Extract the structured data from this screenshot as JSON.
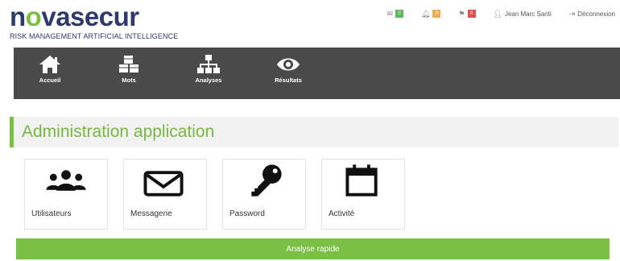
{
  "brand": {
    "name_part1": "n",
    "name_o": "o",
    "name_part2": "vasecur",
    "tagline": "RISK MANAGEMENT ARTIFICIAL INTELLIGENCE",
    "colors": {
      "navy": "#2e3a6e",
      "green": "#7cc043"
    }
  },
  "topbar": {
    "messages": {
      "icon": "envelope-icon",
      "count": "0"
    },
    "alerts": {
      "icon": "bell-icon",
      "count": "0"
    },
    "flags": {
      "icon": "flag-icon",
      "count": "0"
    },
    "user": {
      "icon": "user-icon",
      "name": "Jean Marc Santi"
    },
    "logout": {
      "icon": "logout-icon",
      "label": "Déconnexion"
    }
  },
  "nav": {
    "items": [
      {
        "icon": "home-icon",
        "label": "Accueil"
      },
      {
        "icon": "cubes-icon",
        "label": "Mots"
      },
      {
        "icon": "sitemap-icon",
        "label": "Analyses"
      },
      {
        "icon": "eye-icon",
        "label": "Résultats"
      }
    ]
  },
  "page": {
    "title": "Administration application"
  },
  "tiles": [
    {
      "icon": "users-icon",
      "label": "Utilisateurs"
    },
    {
      "icon": "envelope-icon",
      "label": "Messagerie"
    },
    {
      "icon": "key-icon",
      "label": "Password"
    },
    {
      "icon": "calendar-icon",
      "label": "Activité"
    }
  ],
  "quick_action": {
    "label": "Analyse rapide",
    "color": "#7ac143"
  }
}
